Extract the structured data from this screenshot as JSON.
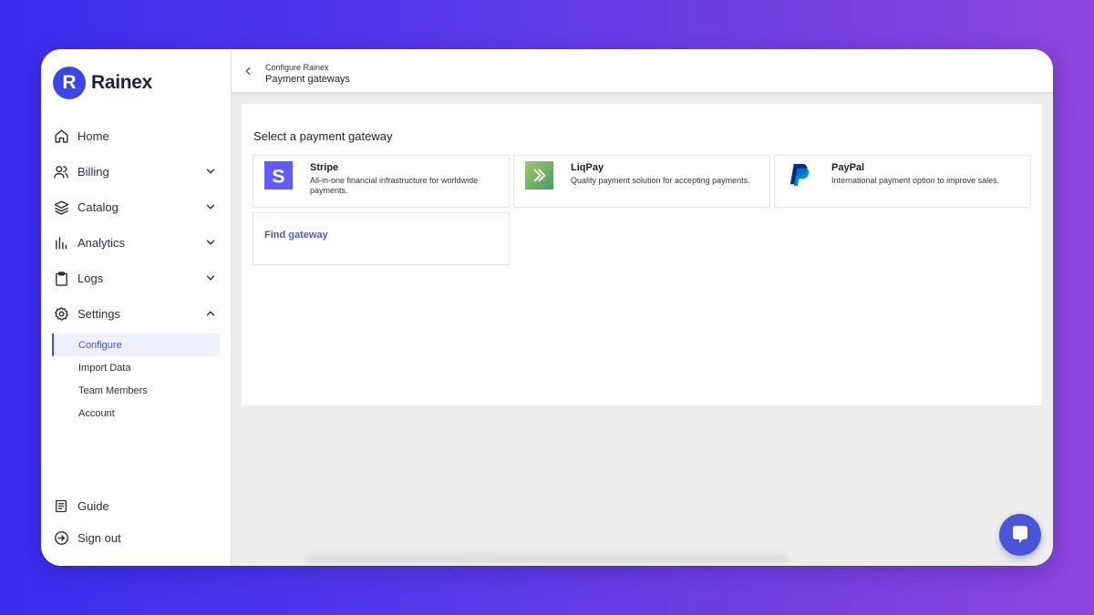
{
  "brand": {
    "name": "Rainex",
    "mark": "R"
  },
  "nav": {
    "home": "Home",
    "billing": "Billing",
    "catalog": "Catalog",
    "analytics": "Analytics",
    "logs": "Logs",
    "settings": "Settings",
    "settings_sub": [
      "Configure",
      "Import Data",
      "Team Members",
      "Account"
    ],
    "guide": "Guide",
    "sign_out": "Sign out"
  },
  "header": {
    "breadcrumb_parent": "Configure Rainex",
    "breadcrumb_current": "Payment gateways"
  },
  "main": {
    "title": "Select a payment gateway",
    "gateways": [
      {
        "name": "Stripe",
        "description": "All-in-one financial infrastructure for worldwide payments.",
        "icon": "stripe-logo",
        "color": "#635bff"
      },
      {
        "name": "LiqPay",
        "description": "Quality payment solution for accepting payments.",
        "icon": "liqpay-logo",
        "color": "#7cb342"
      },
      {
        "name": "PayPal",
        "description": "International payment option to improve sales.",
        "icon": "paypal-logo",
        "color": "#003087"
      }
    ],
    "find_gateway": "Find gateway"
  },
  "colors": {
    "accent": "#4a54c9",
    "brand": "#3d47e8",
    "chat_button": "#4a56d9"
  }
}
